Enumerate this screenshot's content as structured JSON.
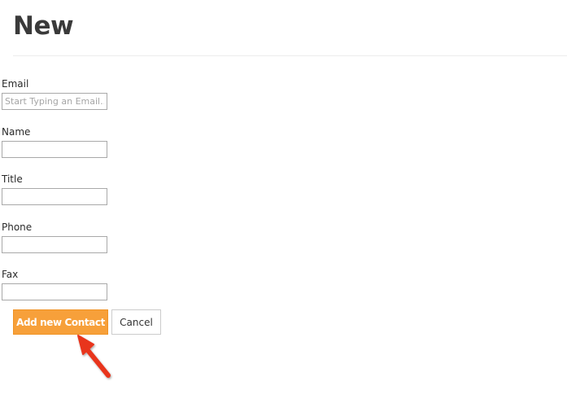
{
  "page": {
    "title": "New"
  },
  "form": {
    "fields": [
      {
        "label": "Email",
        "placeholder": "Start Typing an Email...",
        "value": ""
      },
      {
        "label": "Name",
        "placeholder": "",
        "value": ""
      },
      {
        "label": "Title",
        "placeholder": "",
        "value": ""
      },
      {
        "label": "Phone",
        "placeholder": "",
        "value": ""
      },
      {
        "label": "Fax",
        "placeholder": "",
        "value": ""
      }
    ]
  },
  "actions": {
    "submit_label": "Add new Contact",
    "cancel_label": "Cancel"
  },
  "colors": {
    "primary_button": "#f7a03a",
    "annotation_arrow": "#e8341c"
  },
  "annotation": {
    "icon": "red-arrow-icon"
  }
}
